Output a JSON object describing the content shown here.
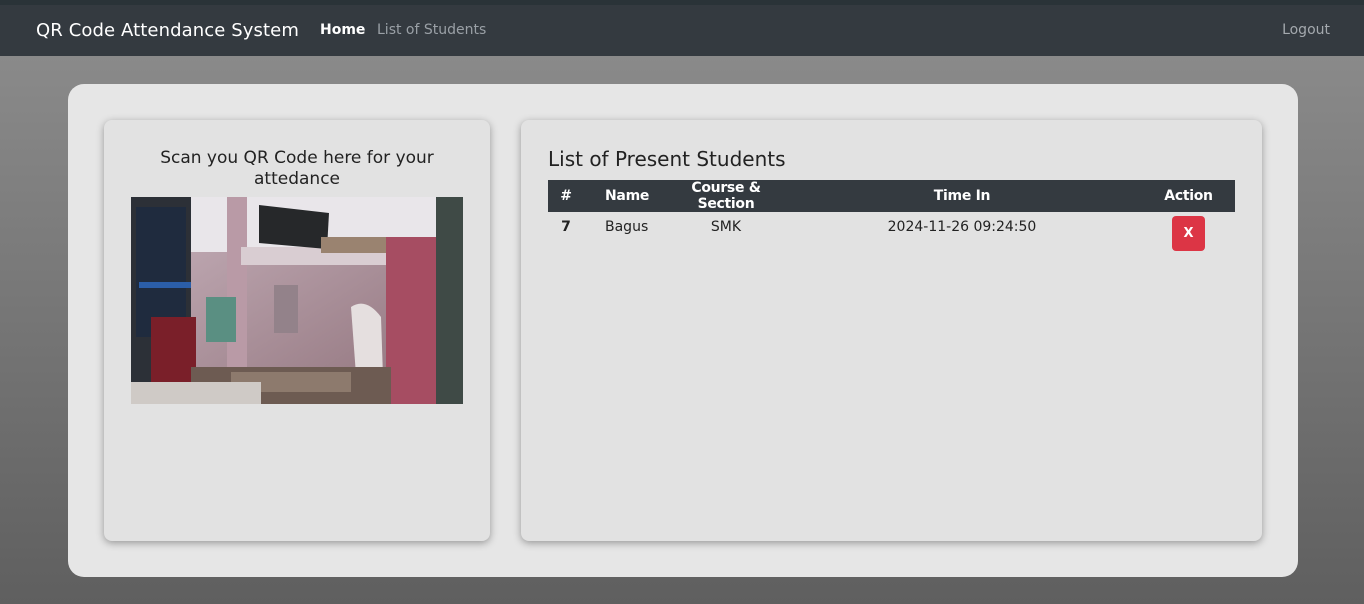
{
  "navbar": {
    "brand": "QR Code Attendance System",
    "home_label": "Home",
    "students_label": "List of Students",
    "logout_label": "Logout"
  },
  "scanner": {
    "title": "Scan you QR Code here for your attedance"
  },
  "attendance": {
    "title": "List of Present Students",
    "columns": [
      "#",
      "Name",
      "Course & Section",
      "Time In",
      "Action"
    ],
    "rows": [
      {
        "id": "7",
        "name": "Bagus",
        "course": "SMK",
        "time_in": "2024-11-26 09:24:50",
        "action_label": "X"
      }
    ]
  },
  "colors": {
    "navbar": "#343a40",
    "delete_button": "#dc3545"
  }
}
